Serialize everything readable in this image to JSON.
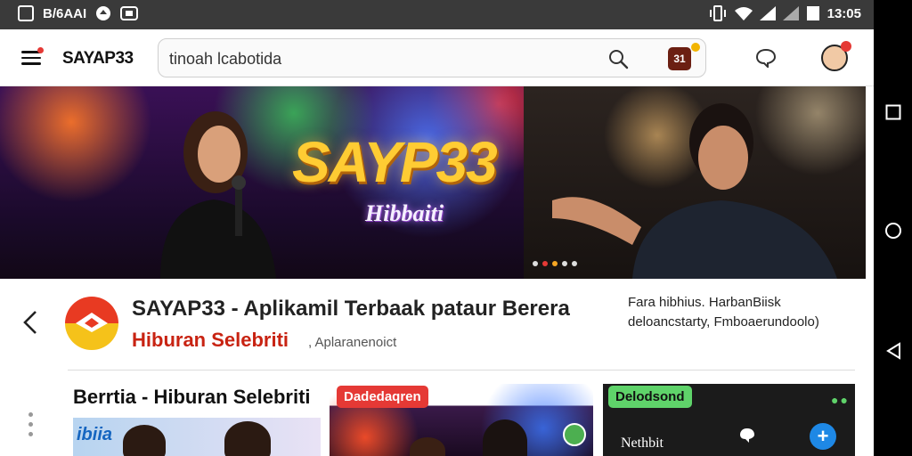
{
  "status_bar": {
    "left_text": "B/6AAI",
    "time": "13:05"
  },
  "header": {
    "brand": "SAYAP33",
    "search": {
      "value": "tinoah lcabotida",
      "placeholder": ""
    },
    "calendar_label": "31",
    "icons": [
      "menu-icon",
      "search-icon",
      "calendar-icon",
      "chat-icon",
      "avatar"
    ]
  },
  "banner": {
    "title": "SAYP33",
    "subtitle": "Hibbaiti",
    "pages": 5,
    "active_page": 2
  },
  "app_info": {
    "title": "SAYAP33 - Aplikamil Terbaak pataur Berera",
    "subtitle": "Hiburan Selebriti",
    "subtitle_extra": ", Aplaranenoict",
    "description_line1": "Fara hibhius. HarbanBiisk",
    "description_line2": "deloancstarty,  Fmboaerundoolo)"
  },
  "section": {
    "title": "Berrtia - Hiburan Selebriti",
    "card1_text": "ibiia",
    "card2_tag": "Dadedaqren",
    "card3_tag": "Delodsond",
    "card3_text": "Nethbit"
  },
  "colors": {
    "accent": "#e53935",
    "brand_red": "#c82312",
    "brand_yellow": "#f5c21a",
    "status_bar": "#3a3a3a"
  }
}
